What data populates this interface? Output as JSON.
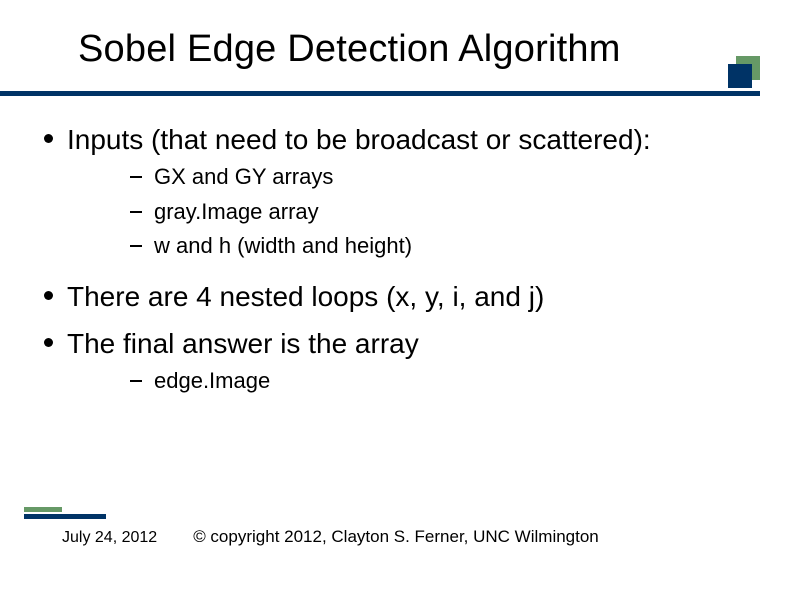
{
  "title": "Sobel Edge Detection Algorithm",
  "bullets": [
    {
      "text": "Inputs (that need to be broadcast or scattered):",
      "sub": [
        "GX and GY arrays",
        "gray.Image array",
        "w and h (width and height)"
      ]
    },
    {
      "text": "There are 4 nested loops (x, y, i, and j)",
      "sub": []
    },
    {
      "text": "The final answer is the array",
      "sub": [
        "edge.Image"
      ]
    }
  ],
  "footer": {
    "date": "July 24, 2012",
    "copyright": "© copyright 2012, Clayton S. Ferner, UNC Wilmington"
  }
}
